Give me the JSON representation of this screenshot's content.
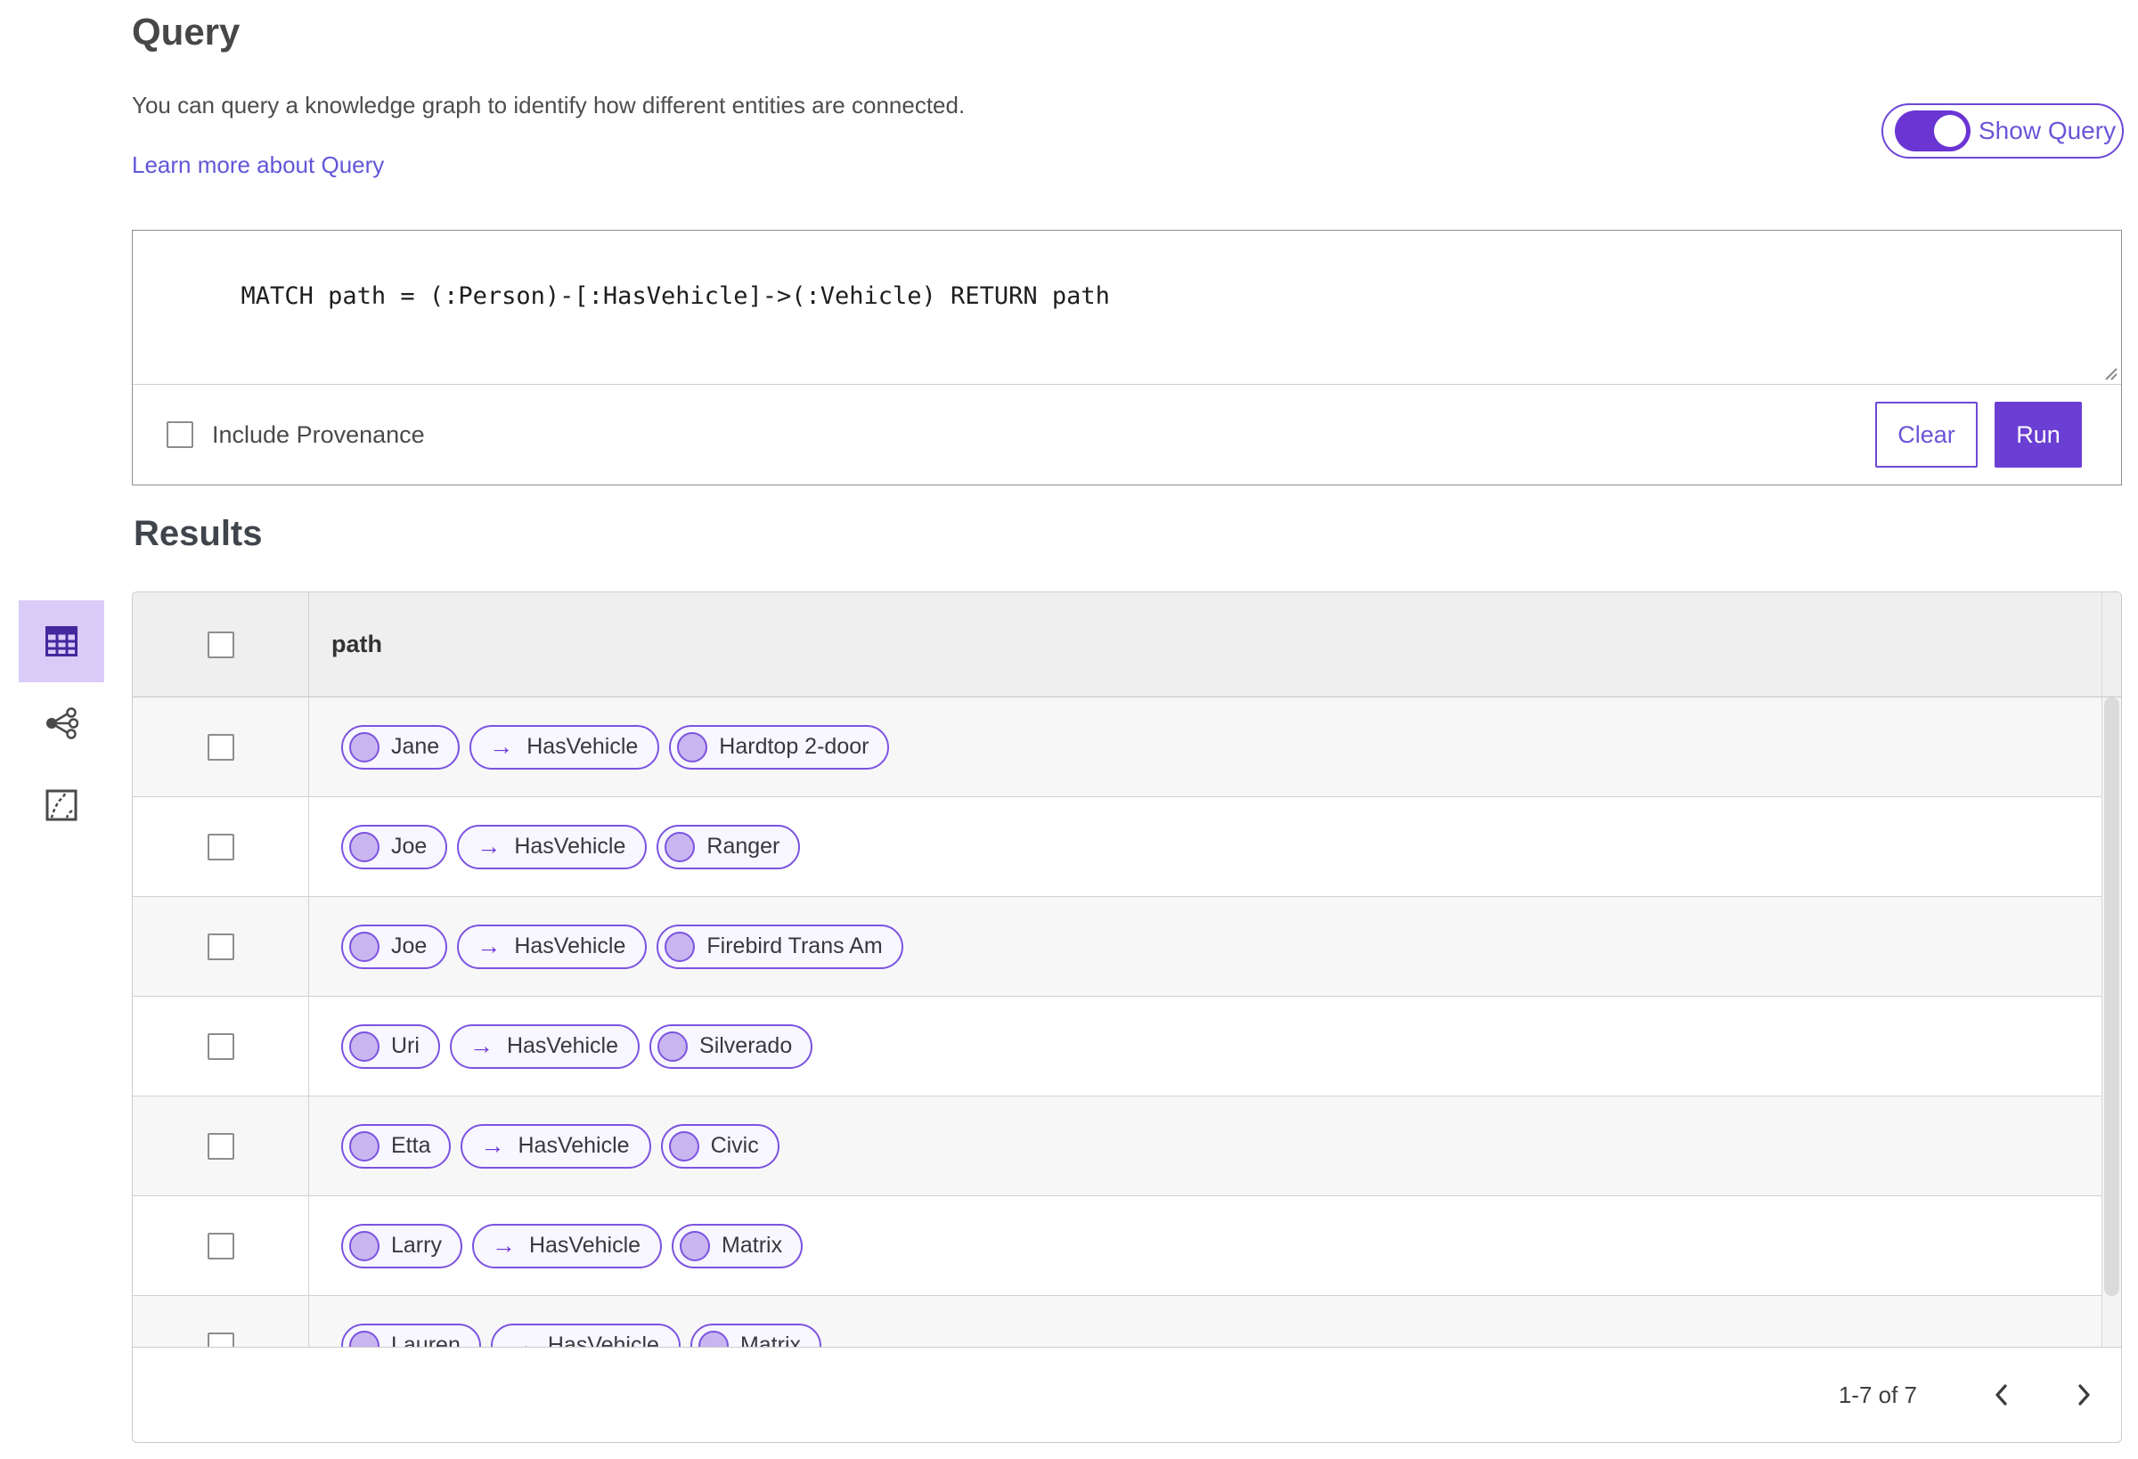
{
  "colors": {
    "accent_purple": "#6b3ed4",
    "accent_border": "#7c53e0",
    "link_purple": "#6156d8",
    "pill_background": "#f8f6fe",
    "pill_node_fill": "#c9b6f0",
    "selected_view_background": "#d9cbf8",
    "table_header_background": "#efeff0",
    "row_stripe": "#f7f7f8"
  },
  "query_section": {
    "title": "Query",
    "description": "You can query a knowledge graph to identify how different entities are connected.",
    "learn_more_label": "Learn more about Query",
    "show_query_label": "Show Query",
    "show_query_state": "on",
    "query_text": "MATCH path = (:Person)-[:HasVehicle]->(:Vehicle) RETURN path",
    "include_provenance_label": "Include Provenance",
    "include_provenance_checked": false,
    "clear_label": "Clear",
    "run_label": "Run"
  },
  "results_section": {
    "title": "Results",
    "column_header": "path",
    "view_options": [
      {
        "name": "table-view",
        "label": "Table view",
        "selected": true
      },
      {
        "name": "link-chart-view",
        "label": "Link chart view",
        "selected": false
      },
      {
        "name": "map-view",
        "label": "Map view",
        "selected": false
      }
    ],
    "rows": [
      {
        "source": "Jane",
        "relation": "HasVehicle",
        "target": "Hardtop 2-door"
      },
      {
        "source": "Joe",
        "relation": "HasVehicle",
        "target": "Ranger"
      },
      {
        "source": "Joe",
        "relation": "HasVehicle",
        "target": "Firebird Trans Am"
      },
      {
        "source": "Uri",
        "relation": "HasVehicle",
        "target": "Silverado"
      },
      {
        "source": "Etta",
        "relation": "HasVehicle",
        "target": "Civic"
      },
      {
        "source": "Larry",
        "relation": "HasVehicle",
        "target": "Matrix"
      },
      {
        "source": "Lauren",
        "relation": "HasVehicle",
        "target": "Matrix"
      }
    ],
    "relation_arrow": "→",
    "pagination": {
      "range_label": "1-7 of 7",
      "prev_icon": "chevron-left-icon",
      "next_icon": "chevron-right-icon"
    }
  }
}
